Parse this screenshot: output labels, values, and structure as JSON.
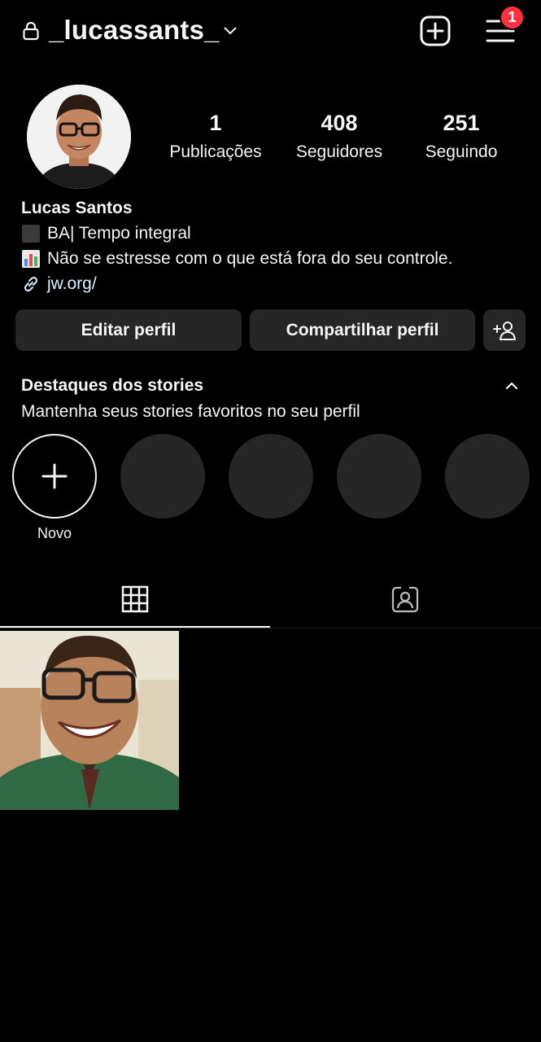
{
  "header": {
    "username": "_lucassants_",
    "notification_count": "1"
  },
  "profile": {
    "stats": [
      {
        "value": "1",
        "label": "Publicações"
      },
      {
        "value": "408",
        "label": "Seguidores"
      },
      {
        "value": "251",
        "label": "Seguindo"
      }
    ],
    "name": "Lucas Santos",
    "bio_line1": "BA| Tempo integral",
    "bio_line2": "Não se estresse com o que está fora do seu controle.",
    "link": "jw.org/"
  },
  "buttons": {
    "edit": "Editar perfil",
    "share": "Compartilhar perfil"
  },
  "highlights": {
    "title": "Destaques dos stories",
    "subtitle": "Mantenha seus stories favoritos no seu perfil",
    "new_label": "Novo"
  },
  "tabs": [
    "grid-icon",
    "tagged-icon"
  ],
  "colors": {
    "background": "#000000",
    "surface": "#262626",
    "badge": "#ff3040",
    "text": "#f5f5f5"
  }
}
